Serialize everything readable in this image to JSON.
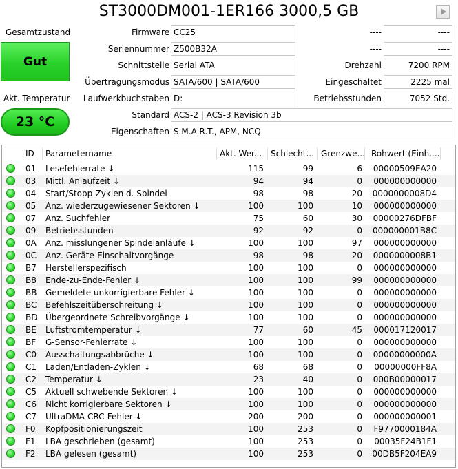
{
  "title": "ST3000DM001-1ER166 3000,5 GB",
  "status_panel": {
    "health_label": "Gesamtzustand",
    "health_value": "Gut",
    "health_color": "#2ad12a",
    "temp_label": "Akt. Temperatur",
    "temp_value": "23 °C"
  },
  "info": {
    "firmware": {
      "label": "Firmware",
      "value": "CC25"
    },
    "serial": {
      "label": "Seriennummer",
      "value": "Z500B32A"
    },
    "interface": {
      "label": "Schnittstelle",
      "value": "Serial ATA"
    },
    "transfer_mode": {
      "label": "Übertragungsmodus",
      "value": "SATA/600 | SATA/600"
    },
    "drive_letters": {
      "label": "Laufwerkbuchstaben",
      "value": "D:"
    },
    "standard": {
      "label": "Standard",
      "value": "ACS-2 | ACS-3 Revision 3b"
    },
    "features": {
      "label": "Eigenschaften",
      "value": "S.M.A.R.T., APM, NCQ"
    },
    "right_1": {
      "label": "----",
      "value": "----"
    },
    "right_2": {
      "label": "----",
      "value": "----"
    },
    "rpm": {
      "label": "Drehzahl",
      "value": "7200 RPM"
    },
    "power_count": {
      "label": "Eingeschaltet",
      "value": "2225 mal"
    },
    "power_hours": {
      "label": "Betriebsstunden",
      "value": "7052 Std."
    }
  },
  "table": {
    "headers": {
      "id": "ID",
      "name": "Parametername",
      "current": "Akt. Wer...",
      "worst": "Schlecht...",
      "threshold": "Grenzwe...",
      "raw": "Rohwert (Einh...."
    },
    "rows": [
      {
        "id": "01",
        "name": "Lesefehlerrate ↓",
        "current": "115",
        "worst": "99",
        "threshold": "6",
        "raw": "00000509EA20"
      },
      {
        "id": "03",
        "name": "Mittl. Anlaufzeit ↓",
        "current": "94",
        "worst": "94",
        "threshold": "0",
        "raw": "000000000000"
      },
      {
        "id": "04",
        "name": "Start/Stopp-Zyklen d. Spindel",
        "current": "98",
        "worst": "98",
        "threshold": "20",
        "raw": "0000000008D4"
      },
      {
        "id": "05",
        "name": "Anz. wiederzugewiesener Sektoren ↓",
        "current": "100",
        "worst": "100",
        "threshold": "10",
        "raw": "000000000000"
      },
      {
        "id": "07",
        "name": "Anz. Suchfehler",
        "current": "75",
        "worst": "60",
        "threshold": "30",
        "raw": "00000276DFBF"
      },
      {
        "id": "09",
        "name": "Betriebsstunden",
        "current": "92",
        "worst": "92",
        "threshold": "0",
        "raw": "000000001B8C"
      },
      {
        "id": "0A",
        "name": "Anz. misslungener Spindelanläufe ↓",
        "current": "100",
        "worst": "100",
        "threshold": "97",
        "raw": "000000000000"
      },
      {
        "id": "0C",
        "name": "Anz. Geräte-Einschaltvorgänge",
        "current": "98",
        "worst": "98",
        "threshold": "20",
        "raw": "0000000008B1"
      },
      {
        "id": "B7",
        "name": "Herstellerspezifisch",
        "current": "100",
        "worst": "100",
        "threshold": "0",
        "raw": "000000000000"
      },
      {
        "id": "B8",
        "name": "Ende-zu-Ende-Fehler ↓",
        "current": "100",
        "worst": "100",
        "threshold": "99",
        "raw": "000000000000"
      },
      {
        "id": "BB",
        "name": "Gemeldete unkorrigierbare Fehler ↓",
        "current": "100",
        "worst": "100",
        "threshold": "0",
        "raw": "000000000000"
      },
      {
        "id": "BC",
        "name": "Befehlszeitüberschreitung ↓",
        "current": "100",
        "worst": "100",
        "threshold": "0",
        "raw": "000000000000"
      },
      {
        "id": "BD",
        "name": "Übergeordnete Schreibvorgänge ↓",
        "current": "100",
        "worst": "100",
        "threshold": "0",
        "raw": "000000000000"
      },
      {
        "id": "BE",
        "name": "Luftstromtemperatur ↓",
        "current": "77",
        "worst": "60",
        "threshold": "45",
        "raw": "000017120017"
      },
      {
        "id": "BF",
        "name": "G-Sensor-Fehlerrate ↓",
        "current": "100",
        "worst": "100",
        "threshold": "0",
        "raw": "000000000000"
      },
      {
        "id": "C0",
        "name": "Ausschaltungsabbrüche ↓",
        "current": "100",
        "worst": "100",
        "threshold": "0",
        "raw": "00000000000A"
      },
      {
        "id": "C1",
        "name": "Laden/Entladen-Zyklen ↓",
        "current": "68",
        "worst": "68",
        "threshold": "0",
        "raw": "00000000FF8A"
      },
      {
        "id": "C2",
        "name": "Temperatur ↓",
        "current": "23",
        "worst": "40",
        "threshold": "0",
        "raw": "000B00000017"
      },
      {
        "id": "C5",
        "name": "Aktuell schwebende Sektoren ↓",
        "current": "100",
        "worst": "100",
        "threshold": "0",
        "raw": "000000000000"
      },
      {
        "id": "C6",
        "name": "Nicht korrigierbare Sektoren ↓",
        "current": "100",
        "worst": "100",
        "threshold": "0",
        "raw": "000000000000"
      },
      {
        "id": "C7",
        "name": "UltraDMA-CRC-Fehler ↓",
        "current": "200",
        "worst": "200",
        "threshold": "0",
        "raw": "000000000001"
      },
      {
        "id": "F0",
        "name": "Kopfpositionierungszeit",
        "current": "100",
        "worst": "253",
        "threshold": "0",
        "raw": "F9770000184A"
      },
      {
        "id": "F1",
        "name": "LBA geschrieben (gesamt)",
        "current": "100",
        "worst": "253",
        "threshold": "0",
        "raw": "00035F24B1F1"
      },
      {
        "id": "F2",
        "name": "LBA gelesen (gesamt)",
        "current": "100",
        "worst": "253",
        "threshold": "0",
        "raw": "00DB5F204EA9"
      }
    ]
  }
}
